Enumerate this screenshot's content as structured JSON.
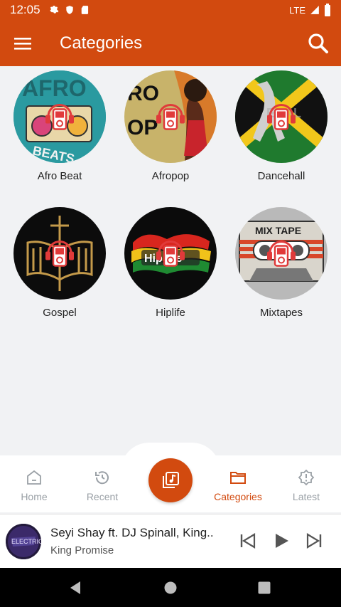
{
  "status_bar": {
    "time": "12:05",
    "network": "LTE"
  },
  "app_bar": {
    "title": "Categories"
  },
  "categories": [
    {
      "label": "Afro Beat"
    },
    {
      "label": "Afropop"
    },
    {
      "label": "Dancehall"
    },
    {
      "label": "Gospel"
    },
    {
      "label": "Hiplife"
    },
    {
      "label": "Mixtapes"
    }
  ],
  "bottom_nav": {
    "items": [
      {
        "label": "Home",
        "icon": "home-icon"
      },
      {
        "label": "Recent",
        "icon": "history-icon"
      },
      {
        "label": "Categories",
        "icon": "folder-icon",
        "active": true
      },
      {
        "label": "Latest",
        "icon": "badge-icon"
      }
    ]
  },
  "mini_player": {
    "title": "Seyi Shay ft. DJ Spinall, King..",
    "artist": "King Promise"
  },
  "colors": {
    "brand": "#d24a0f",
    "inactive": "#9aa0a6"
  }
}
